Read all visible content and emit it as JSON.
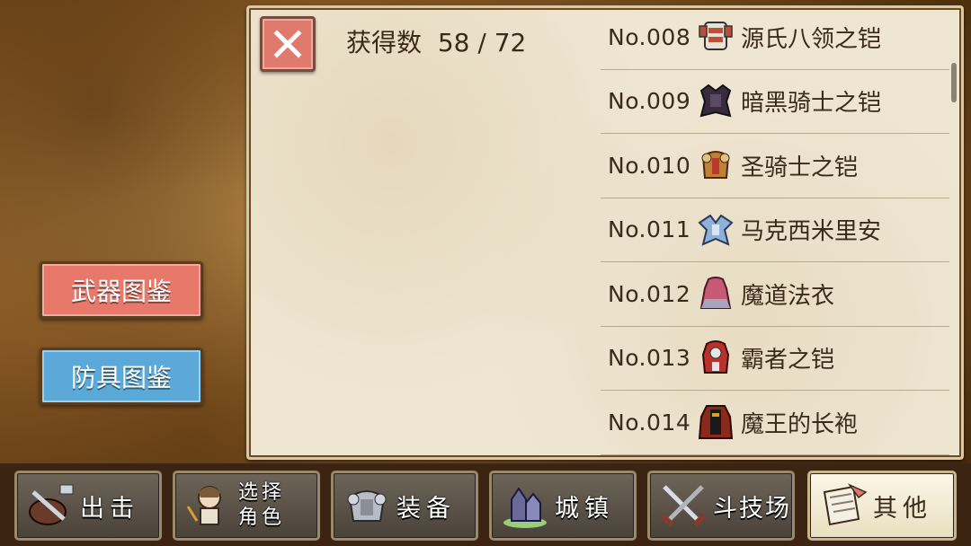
{
  "header": {
    "count_label": "获得数",
    "count_value": "58 / 72"
  },
  "close_button": {
    "icon": "close-icon"
  },
  "side": {
    "weapon_label": "武器图鉴",
    "armor_label": "防具图鉴"
  },
  "armor_list": [
    {
      "num": "No.008",
      "name": "源氏八领之铠",
      "icon": "genji-armor-icon",
      "color": "#b9503c"
    },
    {
      "num": "No.009",
      "name": "暗黑骑士之铠",
      "icon": "dark-knight-armor-icon",
      "color": "#3a2a40"
    },
    {
      "num": "No.010",
      "name": "圣骑士之铠",
      "icon": "paladin-armor-icon",
      "color": "#c0803a"
    },
    {
      "num": "No.011",
      "name": "马克西米里安",
      "icon": "maximilian-armor-icon",
      "color": "#8fb0d8"
    },
    {
      "num": "No.012",
      "name": "魔道法衣",
      "icon": "magic-robe-icon",
      "color": "#c65a72"
    },
    {
      "num": "No.013",
      "name": "霸者之铠",
      "icon": "conqueror-armor-icon",
      "color": "#b8312a"
    },
    {
      "num": "No.014",
      "name": "魔王的长袍",
      "icon": "demon-king-robe-icon",
      "color": "#8a2a1a"
    }
  ],
  "nav": [
    {
      "label": "出击",
      "icon": "sortie-icon"
    },
    {
      "label": "选择角色",
      "label_line1": "选择",
      "label_line2": "角色",
      "icon": "character-icon"
    },
    {
      "label": "装备",
      "icon": "equipment-icon"
    },
    {
      "label": "城镇",
      "icon": "town-icon"
    },
    {
      "label": "斗技场",
      "icon": "arena-icon"
    },
    {
      "label": "其他",
      "icon": "other-icon"
    }
  ]
}
